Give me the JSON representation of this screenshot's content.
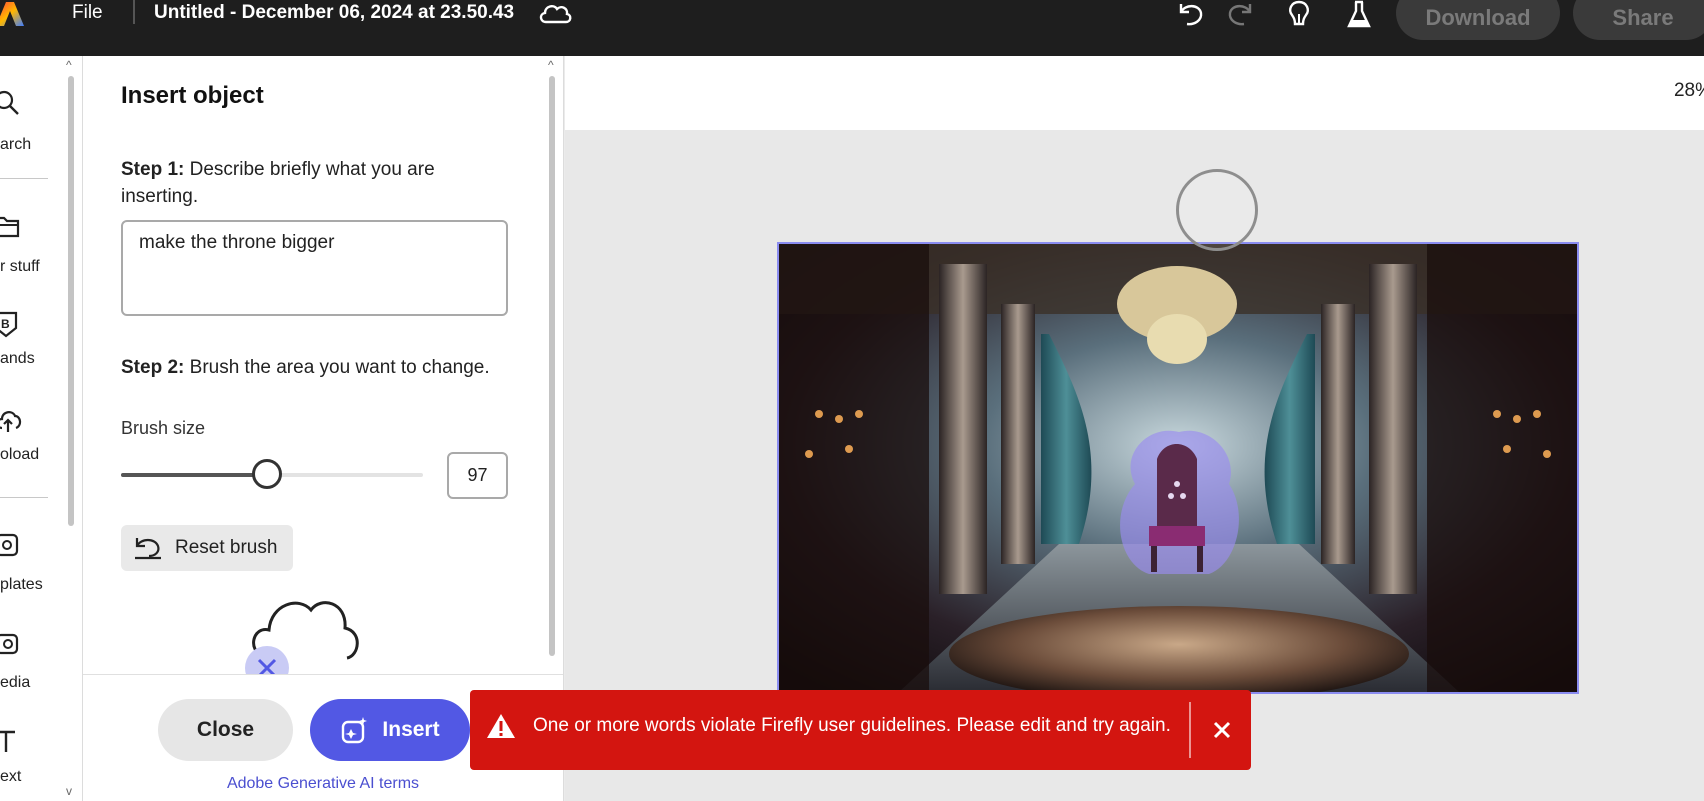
{
  "topbar": {
    "file_label": "File",
    "doc_title": "Untitled - December 06, 2024 at 23.50.43",
    "download_label": "Download",
    "share_label": "Share"
  },
  "rail": {
    "items": [
      {
        "label": "arch",
        "icon": "search-icon"
      },
      {
        "label": "r stuff",
        "icon": "folder-icon"
      },
      {
        "label": "ands",
        "icon": "brand-icon"
      },
      {
        "label": "oload",
        "icon": "upload-icon"
      },
      {
        "label": "plates",
        "icon": "templates-icon"
      },
      {
        "label": "edia",
        "icon": "media-icon"
      },
      {
        "label": "ext",
        "icon": "text-icon"
      }
    ]
  },
  "panel": {
    "title": "Insert object",
    "step1_label": "Step 1:",
    "step1_text": "Describe briefly what you are inserting.",
    "prompt_value": "make the throne bigger",
    "step2_label": "Step 2:",
    "step2_text": "Brush the area you want to change.",
    "brush_size_label": "Brush size",
    "brush_size_value": "97",
    "brush_size_fraction": 0.485,
    "reset_label": "Reset brush",
    "close_label": "Close",
    "insert_label": "Insert",
    "terms_label": "Adobe Generative AI terms"
  },
  "canvas": {
    "zoom": "28%"
  },
  "toast": {
    "message": "One or more words violate Firefly user guidelines. Please edit and try again.",
    "color": "#d31510"
  },
  "colors": {
    "accent": "#5258e4",
    "topbar": "#1e1e1e",
    "selection": "#8a8cf0"
  }
}
